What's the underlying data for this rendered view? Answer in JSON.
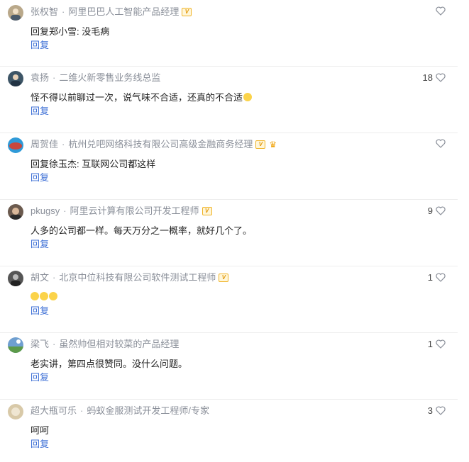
{
  "reply_label": "回复",
  "comments": [
    {
      "name": "张权智",
      "title": "阿里巴巴人工智能产品经理",
      "badge": "V",
      "crown": false,
      "text": "回复郑小雪: 没毛病",
      "likes": "",
      "emoji": false,
      "avatar_color": "#b9a88a"
    },
    {
      "name": "袁扬",
      "title": "二维火新零售业务线总监",
      "badge": "",
      "crown": false,
      "text": "怪不得以前聊过一次，说气味不合适，还真的不合适",
      "likes": "18",
      "emoji": true,
      "avatar_color": "#3d5566"
    },
    {
      "name": "周贺佳",
      "title": "杭州兑吧网络科技有限公司高级金融商务经理",
      "badge": "V",
      "crown": true,
      "text": "回复徐玉杰: 互联网公司都这样",
      "likes": "",
      "emoji": false,
      "avatar_color": "#c9473c"
    },
    {
      "name": "pkugsy",
      "title": "阿里云计算有限公司开发工程师",
      "badge": "V",
      "crown": false,
      "text": "人多的公司都一样。每天万分之一概率，就好几个了。",
      "likes": "9",
      "emoji": false,
      "avatar_color": "#6b5a4e"
    },
    {
      "name": "胡文",
      "title": "北京中位科技有限公司软件测试工程师",
      "badge": "V",
      "crown": false,
      "text": "",
      "likes": "1",
      "emoji": false,
      "avatar_color": "#555555"
    },
    {
      "name": "梁飞",
      "title": "虽然帅但相对较菜的产品经理",
      "badge": "",
      "crown": false,
      "text": "老实讲，第四点很赞同。没什么问题。",
      "likes": "1",
      "emoji": false,
      "avatar_color": "#6f9fd0"
    },
    {
      "name": "超大瓶可乐",
      "title": "蚂蚁金服测试开发工程师/专家",
      "badge": "",
      "crown": false,
      "text": "呵呵",
      "likes": "3",
      "emoji": false,
      "avatar_color": "#d8c9a8"
    }
  ]
}
